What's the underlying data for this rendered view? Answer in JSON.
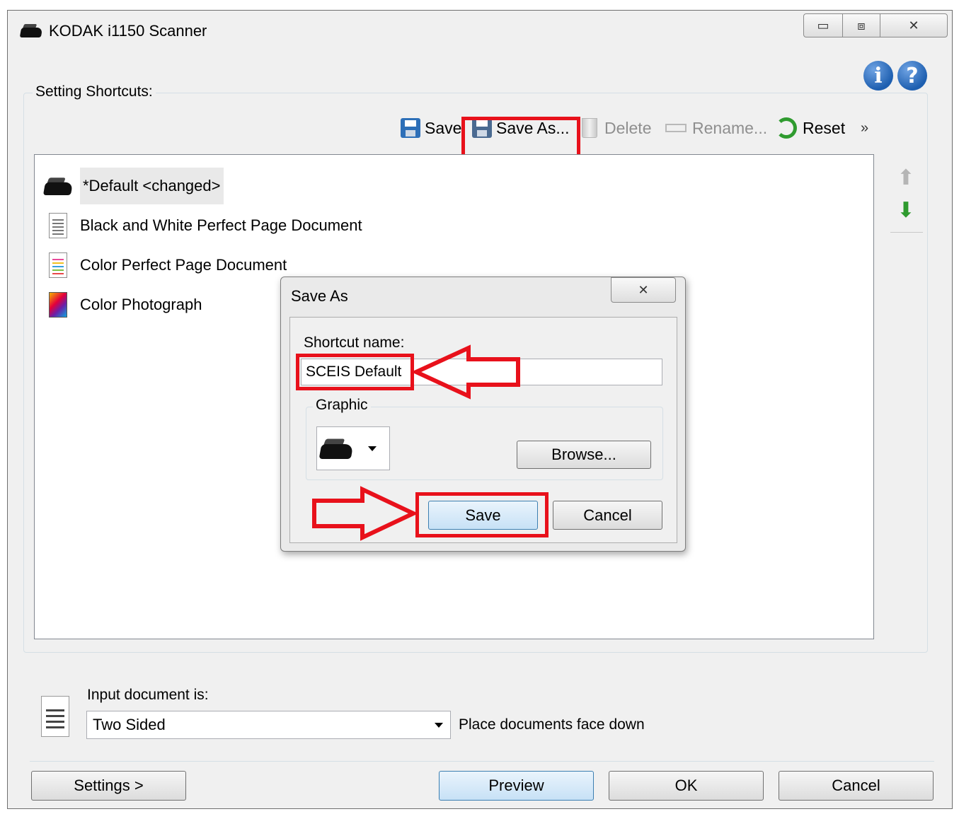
{
  "window": {
    "title": "KODAK i1150 Scanner",
    "controls": {
      "minimize": "▭",
      "maximize": "⧈",
      "close": "✕"
    }
  },
  "help": {
    "info": "i",
    "question": "?"
  },
  "shortcuts": {
    "label": "Setting Shortcuts:",
    "toolbar": {
      "save": "Save",
      "save_as": "Save As...",
      "delete": "Delete",
      "rename": "Rename...",
      "reset": "Reset",
      "more": "»"
    },
    "items": [
      {
        "label": "*Default <changed>",
        "icon": "scanner-icon"
      },
      {
        "label": "Black and White Perfect Page Document",
        "icon": "document-icon"
      },
      {
        "label": "Color Perfect Page Document",
        "icon": "color-document-icon"
      },
      {
        "label": "Color Photograph",
        "icon": "photo-icon"
      }
    ]
  },
  "dialog": {
    "title": "Save As",
    "close": "✕",
    "shortcut_name_label": "Shortcut name:",
    "shortcut_name_value": "SCEIS Default",
    "graphic_label": "Graphic",
    "browse": "Browse...",
    "save": "Save",
    "cancel": "Cancel"
  },
  "input_doc": {
    "label": "Input document is:",
    "value": "Two Sided",
    "hint": "Place documents face down"
  },
  "footer": {
    "settings": "Settings >",
    "preview": "Preview",
    "ok": "OK",
    "cancel": "Cancel"
  },
  "colors": {
    "annotation": "#e8111b",
    "accent_blue": "#1e5fb0"
  }
}
